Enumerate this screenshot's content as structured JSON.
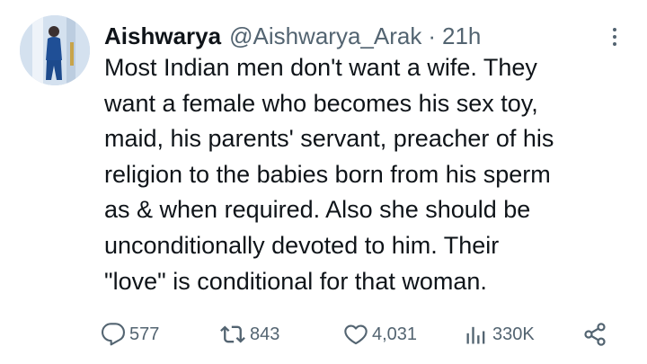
{
  "tweet": {
    "display_name": "Aishwarya",
    "handle": "@Aishwarya_Arak",
    "separator": "·",
    "time": "21h",
    "text": "Most Indian men don't want a wife. They\nwant a female who becomes his sex toy,\nmaid, his parents' servant, preacher of his\nreligion to the babies born from his sperm\nas & when required. Also she should be\nunconditionally devoted to him. Their\n\"love\" is conditional for that woman."
  },
  "actions": {
    "replies": {
      "icon": "reply-icon",
      "count": "577"
    },
    "reposts": {
      "icon": "repost-icon",
      "count": "843"
    },
    "likes": {
      "icon": "heart-icon",
      "count": "4,031"
    },
    "views": {
      "icon": "views-icon",
      "count": "330K"
    },
    "share": {
      "icon": "share-icon"
    }
  },
  "colors": {
    "text_primary": "#0f1419",
    "text_secondary": "#536471",
    "background": "#ffffff"
  }
}
